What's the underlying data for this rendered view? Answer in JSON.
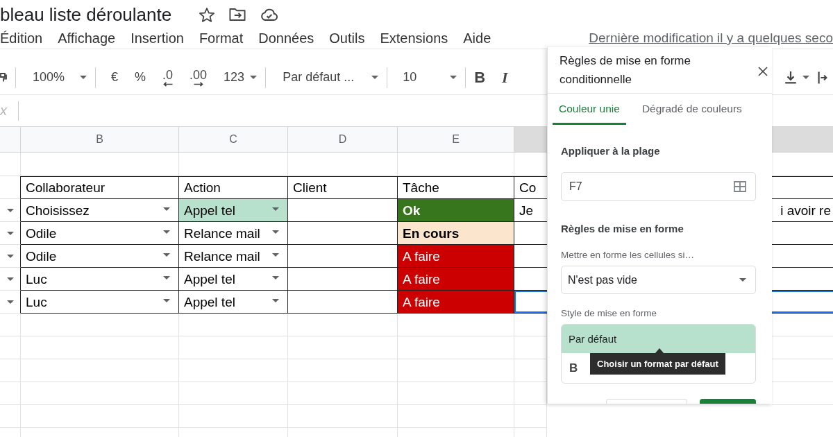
{
  "title_bar": {
    "title": "bleau liste déroulante"
  },
  "menu": {
    "items": [
      "Édition",
      "Affichage",
      "Insertion",
      "Format",
      "Données",
      "Outils",
      "Extensions",
      "Aide"
    ],
    "last_edit": "Dernière modification il y a quelques seco"
  },
  "toolbar": {
    "groups": [
      [
        {
          "kind": "roller"
        }
      ],
      [
        {
          "kind": "dropdown",
          "text": "100%"
        }
      ],
      [
        {
          "kind": "text",
          "text": "€"
        },
        {
          "kind": "text",
          "text": "%"
        },
        {
          "kind": "decrease-decimals",
          "text": ".0"
        },
        {
          "kind": "increase-decimals",
          "text": ".00"
        },
        {
          "kind": "dropdown",
          "text": "123"
        }
      ],
      [
        {
          "kind": "dropdown",
          "text": "Par défaut ..."
        }
      ],
      [
        {
          "kind": "dropdown",
          "text": "10"
        }
      ],
      [
        {
          "kind": "bold",
          "text": "B"
        },
        {
          "kind": "italic",
          "text": "I"
        }
      ]
    ],
    "right_items": [
      {
        "kind": "vertical-align"
      },
      {
        "kind": "wrap"
      }
    ]
  },
  "sheet": {
    "formula_bar": {
      "label": "x"
    },
    "columns": [
      {
        "selected": false
      },
      {
        "label": "B",
        "selected": false
      },
      {
        "label": "C",
        "selected": false
      },
      {
        "label": "D",
        "selected": false
      },
      {
        "label": "E",
        "selected": false
      },
      {
        "selected": true
      }
    ],
    "rows": [
      {
        "kind": "blank"
      },
      {
        "kind": "table",
        "cells": [
          {
            "dropdown": false,
            "selected": false
          },
          {
            "text": "Collaborateur",
            "bold": false,
            "dropdown": false,
            "selected": false
          },
          {
            "text": "Action",
            "bold": false,
            "dropdown": false,
            "selected": false
          },
          {
            "text": "Client",
            "bold": false,
            "dropdown": false,
            "selected": false
          },
          {
            "text": "Tâche",
            "bold": false,
            "dropdown": false,
            "selected": false
          },
          {
            "text": "Co",
            "bold": false,
            "dropdown": false,
            "selected": false
          }
        ]
      },
      {
        "kind": "table",
        "cells": [
          {
            "dropdown": true,
            "selected": false
          },
          {
            "text": "Choisissez",
            "bold": false,
            "dropdown": true,
            "selected": false
          },
          {
            "text": "Appel tel",
            "bold": false,
            "dropdown": true,
            "selected": false,
            "color": "#b7e1cd"
          },
          {
            "dropdown": false,
            "selected": false
          },
          {
            "text": "Ok",
            "bold": true,
            "dropdown": false,
            "selected": false,
            "color": "#38761d"
          },
          {
            "text": "Je",
            "visible_right": "i avoir re",
            "bold": false,
            "dropdown": false,
            "selected": false
          }
        ]
      },
      {
        "kind": "table",
        "cells": [
          {
            "dropdown": true,
            "selected": false
          },
          {
            "text": "Odile",
            "bold": false,
            "dropdown": true,
            "selected": false
          },
          {
            "text": "Relance mail",
            "bold": false,
            "dropdown": true,
            "selected": false
          },
          {
            "dropdown": false,
            "selected": false
          },
          {
            "text": "En cours",
            "bold": true,
            "dropdown": false,
            "selected": false,
            "color": "#fce5cd"
          },
          {
            "dropdown": false,
            "selected": false
          }
        ]
      },
      {
        "kind": "table",
        "cells": [
          {
            "dropdown": true,
            "selected": false
          },
          {
            "text": "Odile",
            "bold": false,
            "dropdown": true,
            "selected": false
          },
          {
            "text": "Relance mail",
            "bold": false,
            "dropdown": true,
            "selected": false
          },
          {
            "dropdown": false,
            "selected": false
          },
          {
            "text": "A faire",
            "bold": false,
            "dropdown": false,
            "selected": false,
            "color": "#cc0000"
          },
          {
            "dropdown": false,
            "selected": false
          }
        ]
      },
      {
        "kind": "table",
        "cells": [
          {
            "dropdown": true,
            "selected": false
          },
          {
            "text": "Luc",
            "bold": false,
            "dropdown": true,
            "selected": false
          },
          {
            "text": "Appel tel",
            "bold": false,
            "dropdown": true,
            "selected": false
          },
          {
            "dropdown": false,
            "selected": false
          },
          {
            "text": "A faire",
            "bold": false,
            "dropdown": false,
            "selected": false,
            "color": "#cc0000"
          },
          {
            "dropdown": false,
            "selected": false
          }
        ]
      },
      {
        "kind": "table",
        "cells": [
          {
            "dropdown": true,
            "selected": false
          },
          {
            "text": "Luc",
            "bold": false,
            "dropdown": true,
            "selected": false
          },
          {
            "text": "Appel tel",
            "bold": false,
            "dropdown": true,
            "selected": false
          },
          {
            "dropdown": false,
            "selected": false
          },
          {
            "text": "A faire",
            "bold": false,
            "dropdown": false,
            "selected": false,
            "color": "#cc0000"
          },
          {
            "dropdown": false,
            "selected": true
          }
        ]
      }
    ]
  },
  "panel": {
    "title": "Règles de mise en forme conditionnelle",
    "tabs": [
      {
        "label": "Couleur unie",
        "selected": true
      },
      {
        "label": "Dégradé de couleurs",
        "selected": false
      }
    ],
    "range": {
      "label": "Appliquer à la plage",
      "value": "F7"
    },
    "rules_heading": "Règles de mise en forme",
    "condition": {
      "label": "Mettre en forme les cellules si…",
      "value": "N'est pas vide"
    },
    "style": {
      "label": "Style de mise en forme",
      "preset": "Par défaut",
      "bold_button": "B",
      "tooltip": "Choisir un format par défaut"
    },
    "buttons": [
      {
        "kind": "outline"
      },
      {
        "kind": "filled"
      }
    ]
  }
}
